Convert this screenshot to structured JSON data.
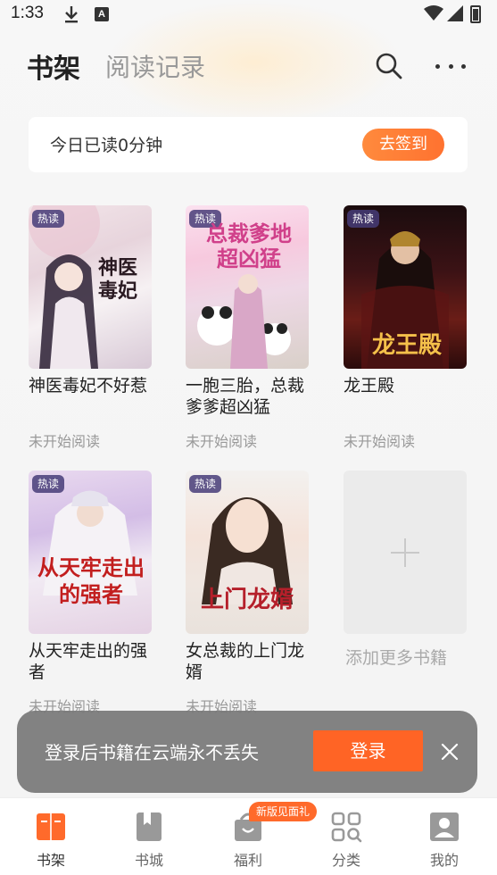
{
  "status_bar": {
    "time": "1:33",
    "a_glyph": "A"
  },
  "header": {
    "tab_active": "书架",
    "tab_inactive": "阅读记录"
  },
  "reading_card": {
    "text": "今日已读0分钟",
    "signin_label": "去签到"
  },
  "books": [
    {
      "title": "神医毒妃不好惹",
      "status": "未开始阅读",
      "badge": "热读",
      "cover_text": "神医毒妃"
    },
    {
      "title": "一胞三胎，总裁爹爹超凶猛",
      "status": "未开始阅读",
      "badge": "热读",
      "cover_text": "总裁爹地超凶猛"
    },
    {
      "title": "龙王殿",
      "status": "未开始阅读",
      "badge": "热读",
      "cover_text": "龙王殿"
    },
    {
      "title": "从天牢走出的强者",
      "status": "未开始阅读",
      "badge": "热读",
      "cover_text": "从天牢走出的强者"
    },
    {
      "title": "女总裁的上门龙婿",
      "status": "未开始阅读",
      "badge": "热读",
      "cover_text": "上门龙婿"
    }
  ],
  "add_more_label": "添加更多书籍",
  "login_banner": {
    "text": "登录后书籍在云端永不丢失",
    "button_label": "登录"
  },
  "bottom_nav": {
    "promo_badge": "新版见面礼",
    "items": [
      {
        "label": "书架"
      },
      {
        "label": "书城"
      },
      {
        "label": "福利"
      },
      {
        "label": "分类"
      },
      {
        "label": "我的"
      }
    ]
  },
  "colors": {
    "accent": "#ff6425",
    "signin_gradient": "#ff8a3d",
    "badge_bg": "#463c78"
  }
}
